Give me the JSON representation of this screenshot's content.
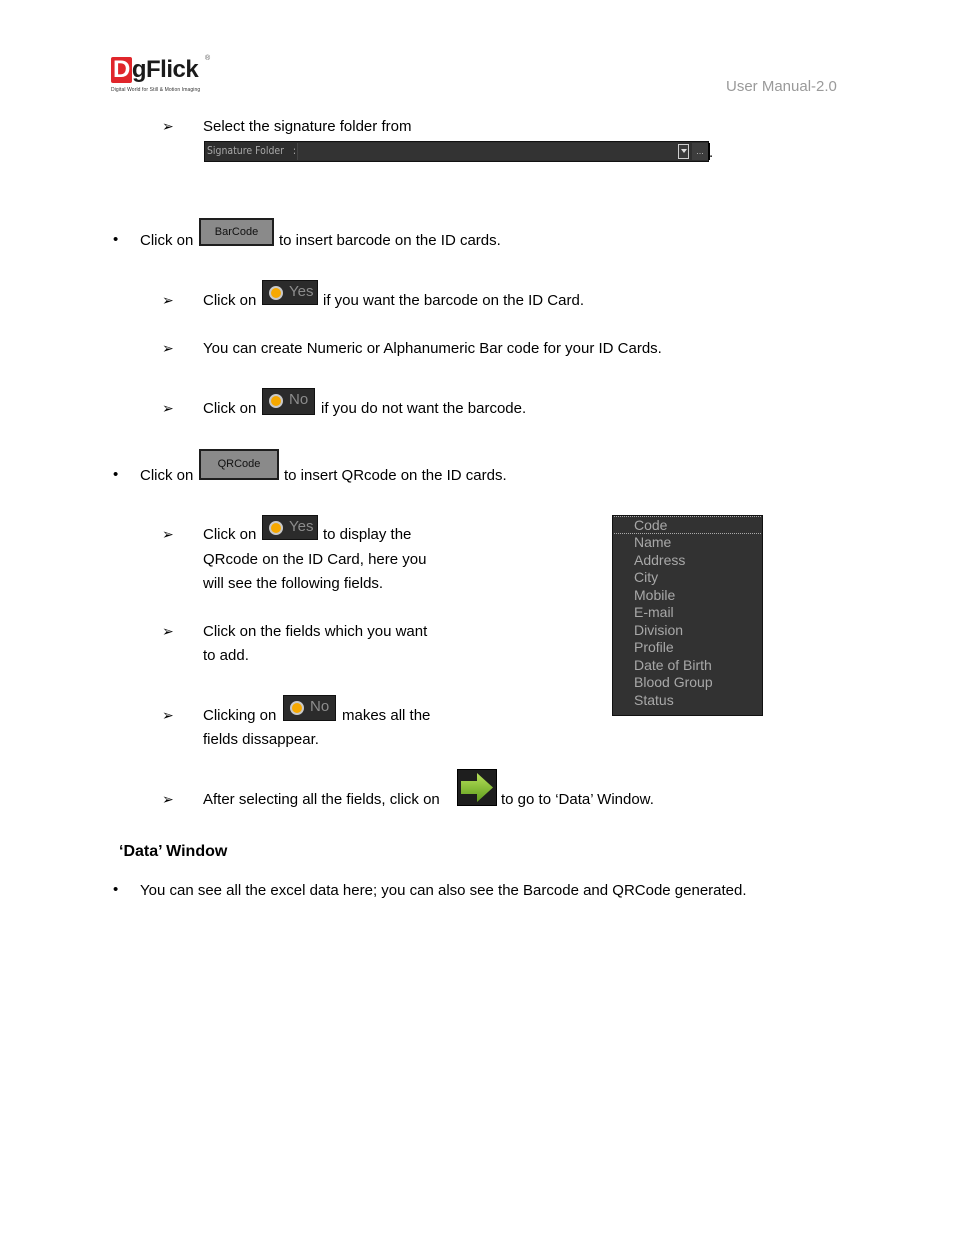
{
  "header": {
    "logo_letter": "D",
    "logo_rest": "gFlick",
    "logo_registered": "®",
    "logo_tagline": "Digital World for Still & Motion Imaging",
    "manual_version": "User Manual-2.0"
  },
  "signature": {
    "instruction": "Select the signature folder from",
    "control_label": "Signature Folder",
    "control_separator": ":",
    "field_value": "",
    "browse_label": "...",
    "trailing": "."
  },
  "barcode": {
    "prefix": "Click on",
    "button_label": "BarCode",
    "suffix": "to insert barcode on the ID cards.",
    "yes_prefix": "Click on",
    "yes_label": "Yes",
    "yes_suffix": "if you want the barcode on the ID Card.",
    "numeric_note": "You can create Numeric or Alphanumeric Bar code for your ID Cards.",
    "no_prefix": "Click on",
    "no_label": "No",
    "no_suffix": "if you do not want the barcode."
  },
  "qrcode": {
    "prefix": "Click on",
    "button_label": "QRCode",
    "suffix": "to insert QRcode on the ID cards.",
    "yes_prefix": "Click on",
    "yes_label": "Yes",
    "yes_suffix_line1": "to display the",
    "yes_line2": "QRcode on the ID Card, here you",
    "yes_line3": "will see the following fields.",
    "fields_line1": "Click on the fields which you want",
    "fields_line2": "to add.",
    "no_prefix": "Clicking on",
    "no_label": "No",
    "no_suffix_line1": "makes all the",
    "no_line2": "fields dissappear.",
    "after_prefix": "After selecting all the fields, click on",
    "after_suffix": "to go to ‘Data’ Window.",
    "fields": [
      "Code",
      "Name",
      "Address",
      "City",
      "Mobile",
      "E-mail",
      "Division",
      "Profile",
      "Date of Birth",
      "Blood Group",
      "Status"
    ],
    "selected_field": "Code"
  },
  "data_window": {
    "heading": "‘Data’ Window",
    "bullet": "You can see all the excel data here; you can also see the Barcode and QRCode generated."
  },
  "glyphs": {
    "bullet": "•",
    "arrow": "➢"
  }
}
